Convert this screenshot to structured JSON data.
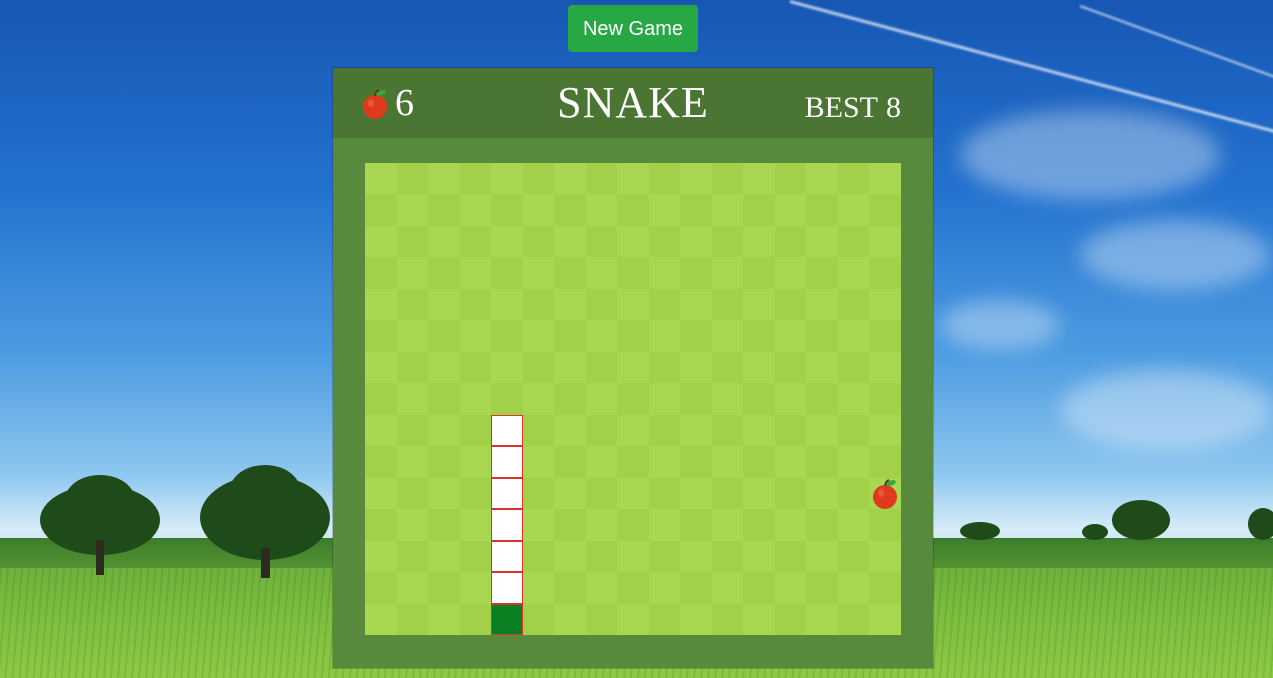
{
  "app": {
    "title": "SNAKE"
  },
  "controls": {
    "new_game_label": "New Game"
  },
  "header": {
    "score": "6",
    "score_icon": "apple-icon",
    "best_label": "BEST",
    "best_value": "8"
  },
  "board": {
    "columns": 17,
    "rows": 15,
    "snake": {
      "head": [
        4,
        14
      ],
      "body": [
        [
          4,
          8
        ],
        [
          4,
          9
        ],
        [
          4,
          10
        ],
        [
          4,
          11
        ],
        [
          4,
          12
        ],
        [
          4,
          13
        ]
      ]
    },
    "food": [
      16,
      10
    ],
    "food_icon": "apple-icon"
  },
  "colors": {
    "new_game_button": "#28a745",
    "header": "#4a7533",
    "frame": "#578a3c",
    "board_light": "#aad751",
    "board_dark": "#a2d149",
    "snake_head": "#0a8023",
    "snake_body": "#ffffff",
    "snake_outline": "#d9342b",
    "apple": "#e03a1e"
  }
}
